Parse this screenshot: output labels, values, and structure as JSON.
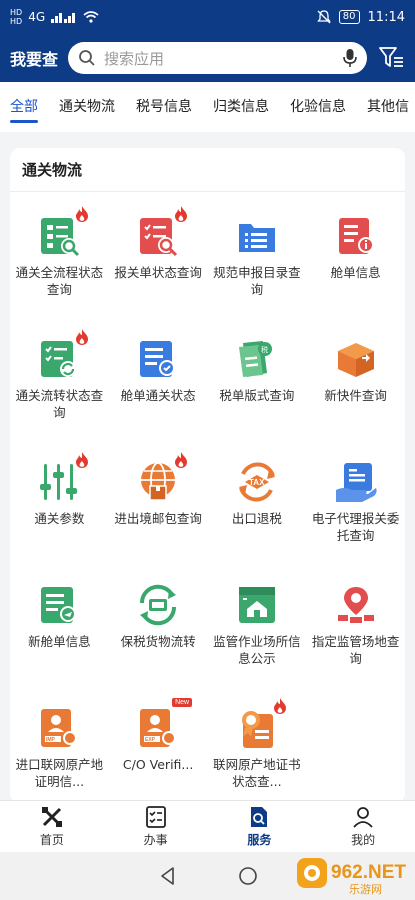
{
  "status": {
    "network": "4G",
    "battery": "80",
    "time": "11:14"
  },
  "header": {
    "title": "我要查",
    "search_placeholder": "搜索应用"
  },
  "tabs": [
    "全部",
    "通关物流",
    "税号信息",
    "归类信息",
    "化验信息",
    "其他信"
  ],
  "section": {
    "title": "通关物流",
    "items": [
      {
        "label": "通关全流程状态查询",
        "icon": "clearance-flow-icon",
        "hot": true
      },
      {
        "label": "报关单状态查询",
        "icon": "declaration-search-icon",
        "hot": true
      },
      {
        "label": "规范申报目录查询",
        "icon": "declaration-catalog-icon",
        "hot": false
      },
      {
        "label": "舱单信息",
        "icon": "manifest-info-icon",
        "hot": false
      },
      {
        "label": "通关流转状态查询",
        "icon": "clearance-transfer-icon",
        "hot": true
      },
      {
        "label": "舱单通关状态",
        "icon": "manifest-status-icon",
        "hot": false
      },
      {
        "label": "税单版式查询",
        "icon": "tax-form-icon",
        "hot": false
      },
      {
        "label": "新快件查询",
        "icon": "express-parcel-icon",
        "hot": false
      },
      {
        "label": "通关参数",
        "icon": "parameters-icon",
        "hot": true
      },
      {
        "label": "进出境邮包查询",
        "icon": "postal-parcel-icon",
        "hot": true
      },
      {
        "label": "出口退税",
        "icon": "tax-refund-icon",
        "hot": false
      },
      {
        "label": "电子代理报关委托查询",
        "icon": "agent-delegation-icon",
        "hot": false
      },
      {
        "label": "新舱单信息",
        "icon": "new-manifest-icon",
        "hot": false
      },
      {
        "label": "保税货物流转",
        "icon": "bonded-goods-icon",
        "hot": false
      },
      {
        "label": "监管作业场所信息公示",
        "icon": "supervision-site-icon",
        "hot": false
      },
      {
        "label": "指定监管场地查询",
        "icon": "designated-site-icon",
        "hot": false
      },
      {
        "label": "进口联网原产地证明信...",
        "icon": "import-origin-icon",
        "hot": false
      },
      {
        "label": "C/O Verifi...",
        "icon": "co-verification-icon",
        "hot": false,
        "tag": "New"
      },
      {
        "label": "联网原产地证书状态查...",
        "icon": "origin-certificate-icon",
        "hot": true
      }
    ]
  },
  "bottom_nav": [
    {
      "label": "首页",
      "icon": "home-icon"
    },
    {
      "label": "办事",
      "icon": "tasks-icon"
    },
    {
      "label": "服务",
      "icon": "service-icon",
      "active": true
    },
    {
      "label": "我的",
      "icon": "profile-icon"
    }
  ],
  "watermark": {
    "brand": "962.NET",
    "sub": "乐游网"
  },
  "colors": {
    "header": "#0d3b86",
    "accent": "#1a56c9",
    "green": "#3aa76d",
    "red": "#e24d4d",
    "blue": "#3a7be0",
    "orange": "#e87a35"
  }
}
